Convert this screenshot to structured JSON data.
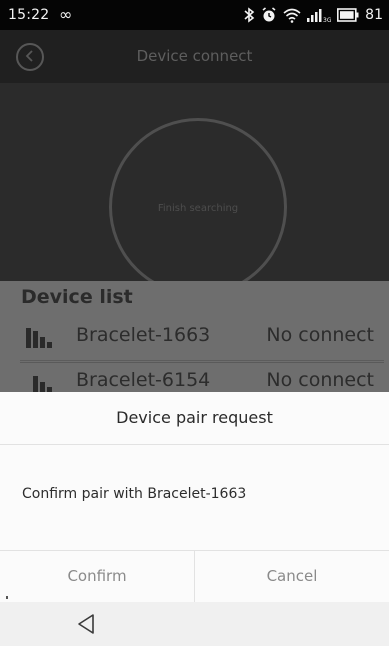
{
  "status_bar": {
    "time": "15:22",
    "infinity_symbol": "∞",
    "icons": [
      "bluetooth-icon",
      "alarm-icon",
      "wifi-icon",
      "signal-icon",
      "battery-icon"
    ],
    "battery": "81"
  },
  "header": {
    "title": "Device connect",
    "back_icon": "chevron-left-icon"
  },
  "search": {
    "status_text": "Finish searching"
  },
  "device_list": {
    "title": "Device list",
    "items": [
      {
        "name": "Bracelet-1663",
        "status": "No connect"
      },
      {
        "name": "Bracelet-6154",
        "status": "No connect"
      }
    ]
  },
  "dialog": {
    "title": "Device pair request",
    "message": "Confirm pair with Bracelet-1663",
    "confirm_label": "Confirm",
    "cancel_label": "Cancel"
  },
  "nav_bar": {
    "back_icon": "triangle-back-icon"
  },
  "colors": {
    "status_bar": "#050505",
    "overlay_header": "#202020",
    "search_area": "#2b2b2b",
    "device_section": "#6e6e6e",
    "dialog_bg": "#fbfbfb",
    "button_text": "#8a8a8a"
  }
}
